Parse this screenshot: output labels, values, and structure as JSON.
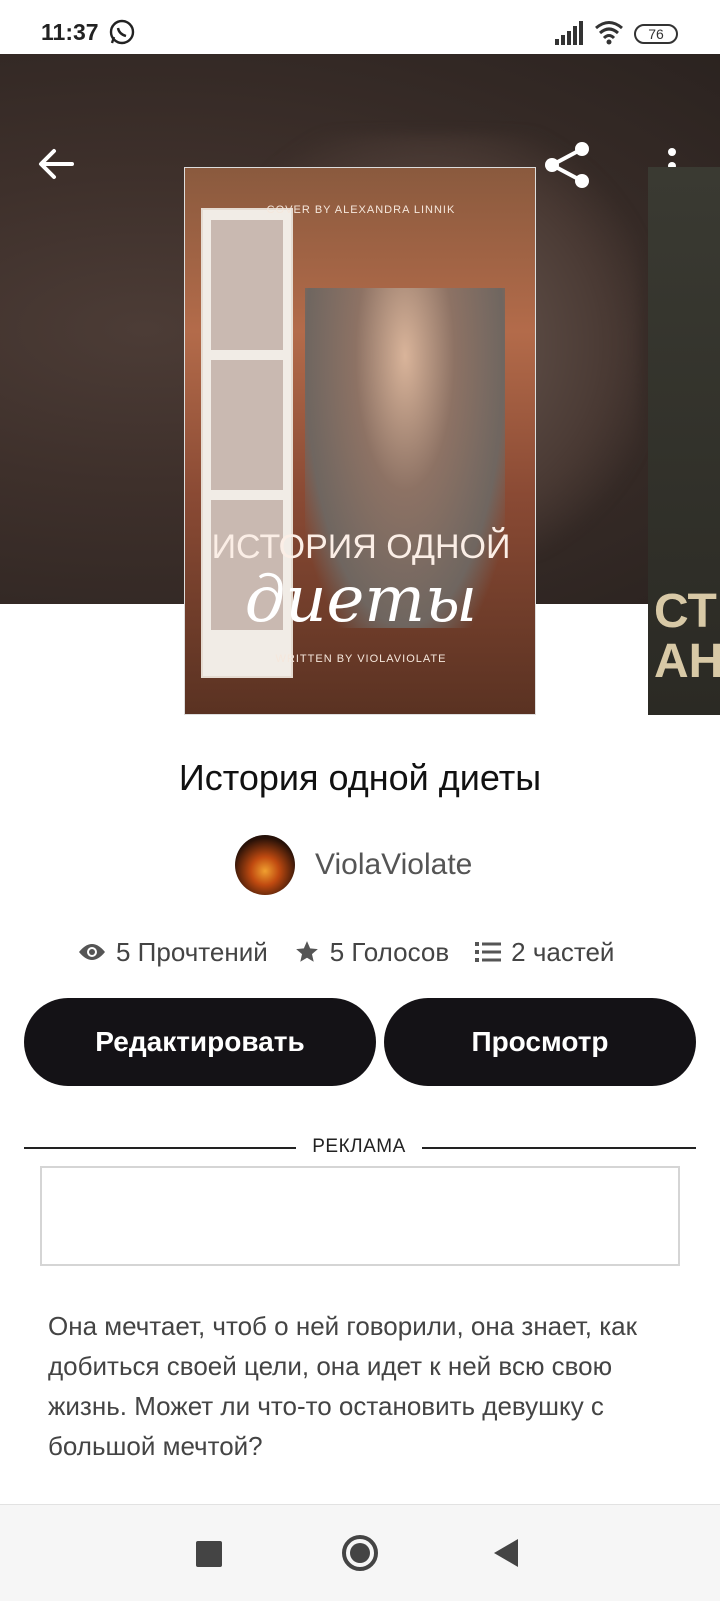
{
  "status_bar": {
    "time": "11:37",
    "battery": "76",
    "icons": [
      "whatsapp-icon",
      "signal-icon",
      "wifi-icon",
      "battery-icon"
    ]
  },
  "toolbar": {
    "icons": [
      "back-arrow-icon",
      "share-icon",
      "more-vertical-icon"
    ]
  },
  "cover": {
    "top_credit": "COVER BY ALEXANDRA LINNIK",
    "title_line1": "ИСТОРИЯ ОДНОЙ",
    "title_line2": "диеты",
    "bottom_credit": "WRITTEN BY VIOLAVIOLATE"
  },
  "next_cover": {
    "text": "СТ\nАН"
  },
  "book": {
    "title": "История одной диеты",
    "author": "ViolaViolate"
  },
  "stats": {
    "reads": "5 Прочтений",
    "votes": "5 Голосов",
    "parts": "2 частей"
  },
  "buttons": {
    "edit": "Редактировать",
    "view": "Просмотр"
  },
  "ad": {
    "label": "РЕКЛАМА"
  },
  "description": "Она мечтает, чтоб о ней говорили, она знает, как добиться своей цели, она идет к ней всю свою жизнь. Может ли что-то остановить девушку с большой мечтой?",
  "nav": {
    "icons": [
      "recents-square-icon",
      "home-circle-icon",
      "back-triangle-icon"
    ]
  }
}
